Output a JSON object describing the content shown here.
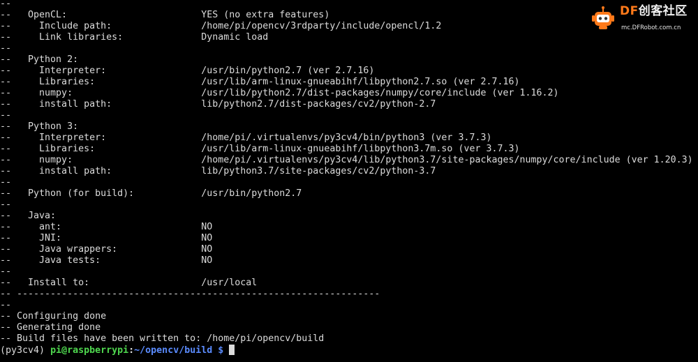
{
  "terminal": {
    "lines": [
      "--",
      "--   OpenCL:                        YES (no extra features)",
      "--     Include path:                /home/pi/opencv/3rdparty/include/opencl/1.2",
      "--     Link libraries:              Dynamic load",
      "--",
      "--   Python 2:",
      "--     Interpreter:                 /usr/bin/python2.7 (ver 2.7.16)",
      "--     Libraries:                   /usr/lib/arm-linux-gnueabihf/libpython2.7.so (ver 2.7.16)",
      "--     numpy:                       /usr/lib/python2.7/dist-packages/numpy/core/include (ver 1.16.2)",
      "--     install path:                lib/python2.7/dist-packages/cv2/python-2.7",
      "--",
      "--   Python 3:",
      "--     Interpreter:                 /home/pi/.virtualenvs/py3cv4/bin/python3 (ver 3.7.3)",
      "--     Libraries:                   /usr/lib/arm-linux-gnueabihf/libpython3.7m.so (ver 3.7.3)",
      "--     numpy:                       /home/pi/.virtualenvs/py3cv4/lib/python3.7/site-packages/numpy/core/include (ver 1.20.3)",
      "--     install path:                lib/python3.7/site-packages/cv2/python-3.7",
      "--",
      "--   Python (for build):            /usr/bin/python2.7",
      "--",
      "--   Java:",
      "--     ant:                         NO",
      "--     JNI:                         NO",
      "--     Java wrappers:               NO",
      "--     Java tests:                  NO",
      "--",
      "--   Install to:                    /usr/local",
      "-- -----------------------------------------------------------------",
      "--",
      "-- Configuring done",
      "-- Generating done",
      "-- Build files have been written to: /home/pi/opencv/build"
    ],
    "prompt": {
      "venv": "(py3cv4) ",
      "user_host": "pi@raspberrypi",
      "separator": ":",
      "path": "~/opencv/build",
      "symbol": " $"
    }
  },
  "watermark": {
    "brand_prefix": "DF",
    "brand_suffix": "创客社区",
    "url": "mc.DFRobot.com.cn",
    "icon": "robot-icon"
  },
  "colors": {
    "background": "#000000",
    "text": "#dcdcdc",
    "user_host": "#4fd84f",
    "path": "#5b8cff",
    "brand_accent": "#ff7a1a"
  }
}
